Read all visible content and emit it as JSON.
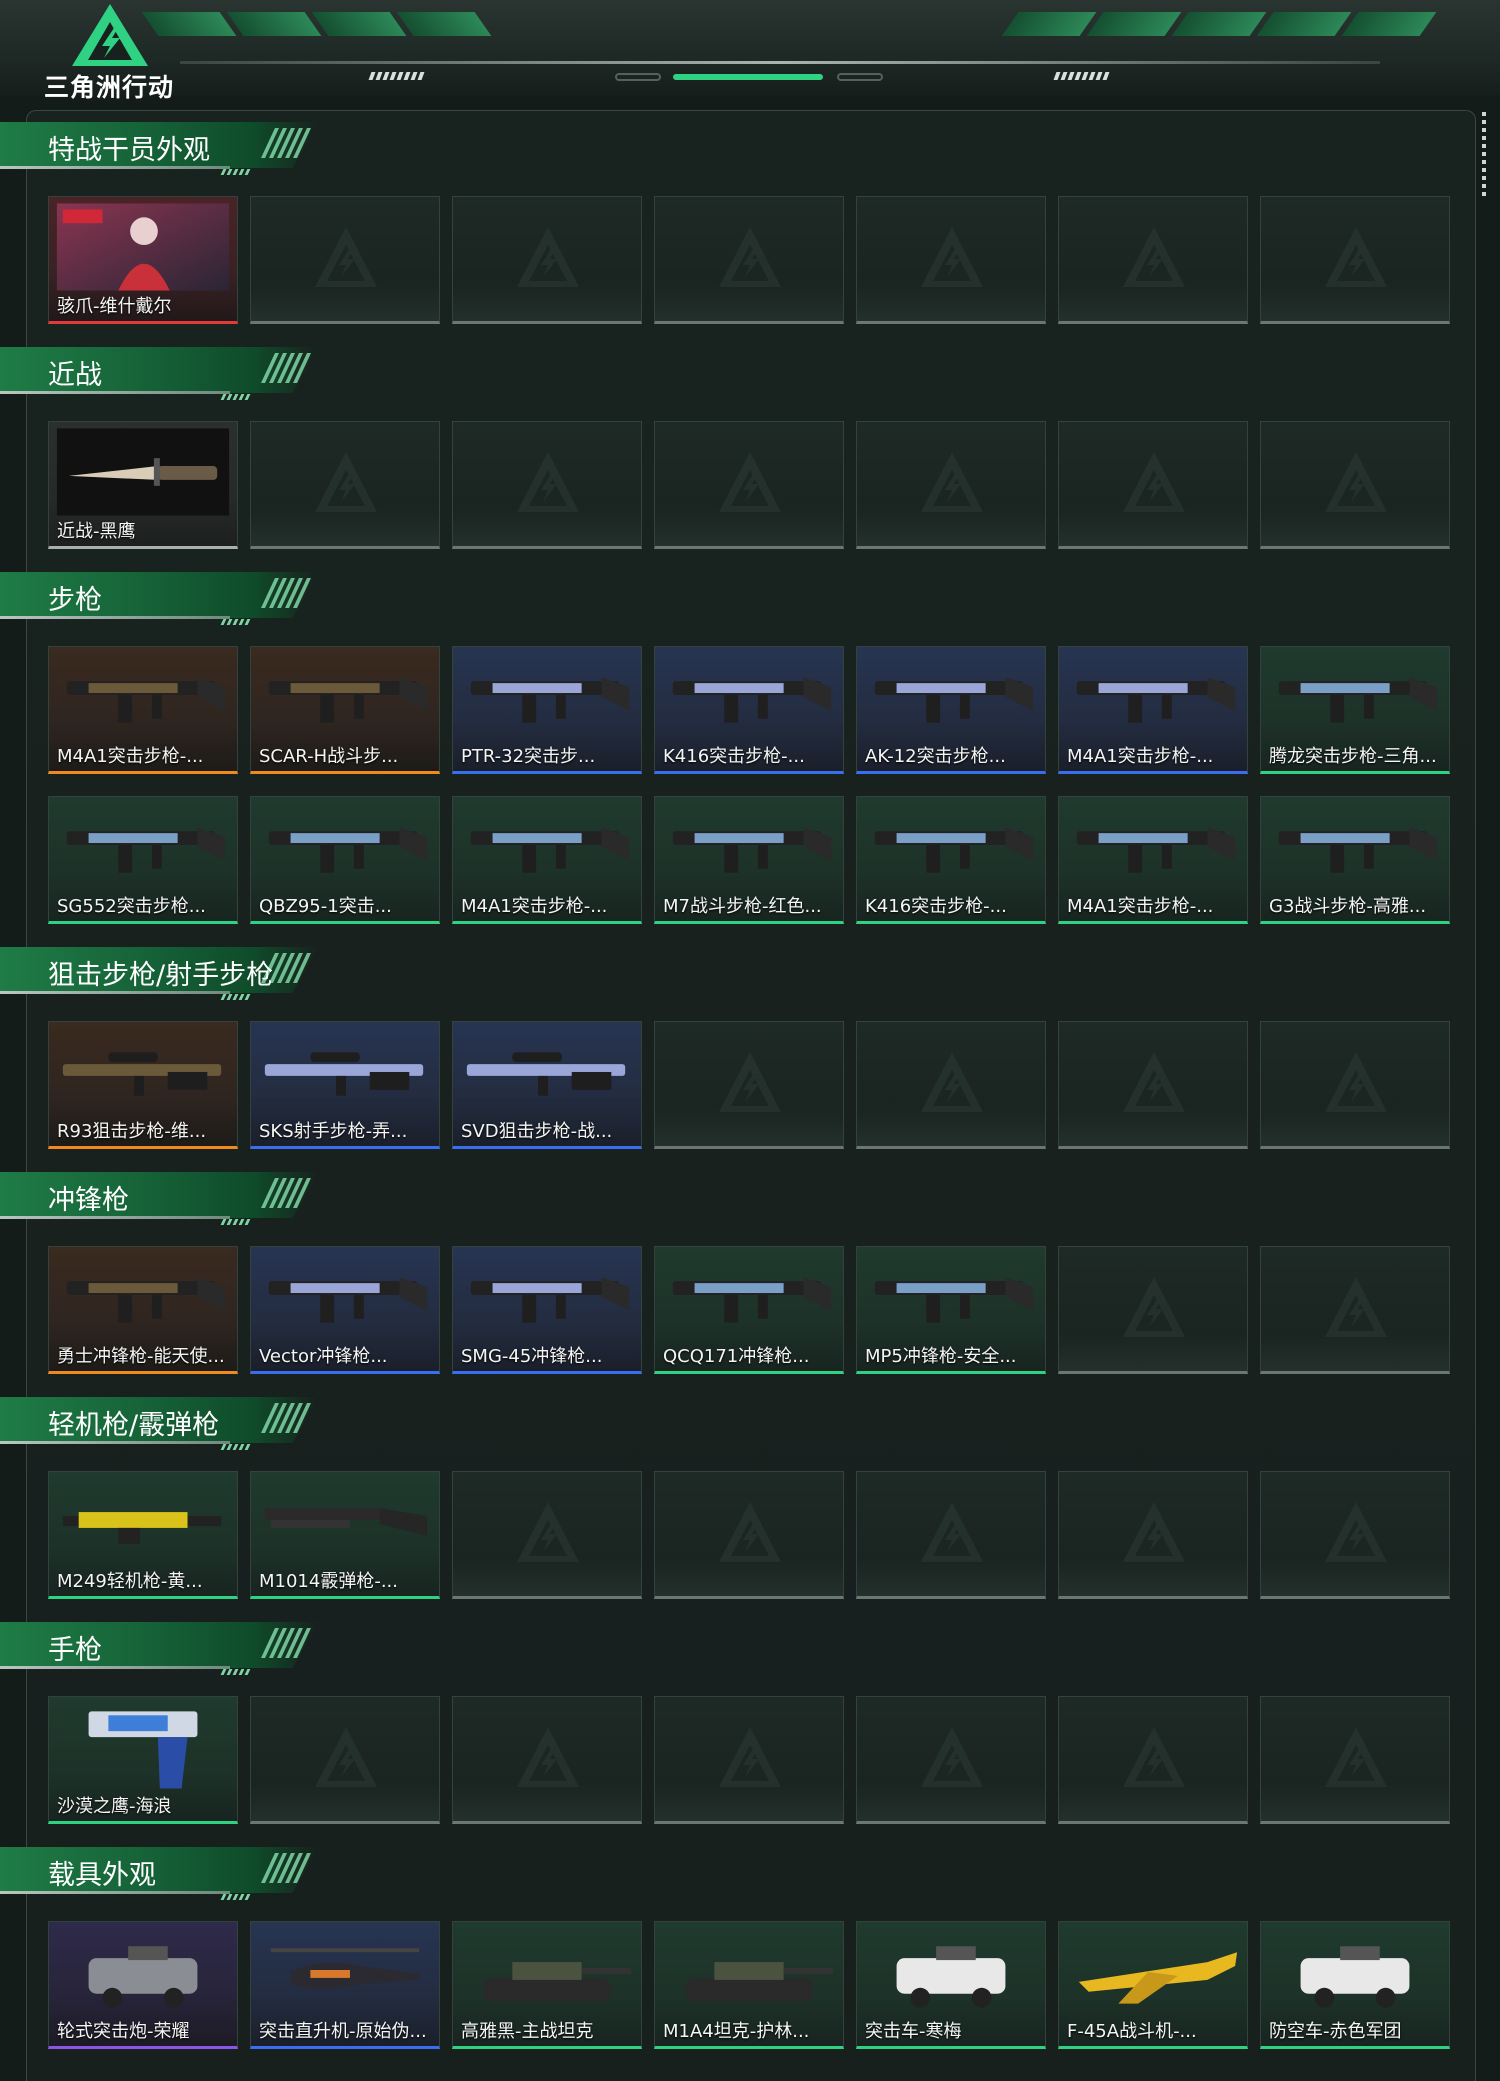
{
  "brand": {
    "name": "三角洲行动"
  },
  "colors": {
    "accent_green": "#2fd283",
    "rarity_orange": "#f08a1c",
    "rarity_blue": "#3a6ef0",
    "rarity_purple": "#8a56e8",
    "rarity_green": "#2fd283",
    "rarity_red": "#e23a3a",
    "rarity_gray": "#a8b0ad"
  },
  "categories": [
    {
      "title": "特战干员外观",
      "rows": [
        [
          {
            "label": "骇爪-维什戴尔",
            "rarity": "red",
            "icon": "operator-portrait"
          },
          null,
          null,
          null,
          null,
          null,
          null
        ]
      ]
    },
    {
      "title": "近战",
      "rows": [
        [
          {
            "label": "近战-黑鹰",
            "rarity": "gray",
            "icon": "knife-icon"
          },
          null,
          null,
          null,
          null,
          null,
          null
        ]
      ]
    },
    {
      "title": "步枪",
      "rows": [
        [
          {
            "label": "M4A1突击步枪-...",
            "rarity": "orange",
            "icon": "rifle-icon"
          },
          {
            "label": "SCAR-H战斗步...",
            "rarity": "orange",
            "icon": "rifle-icon"
          },
          {
            "label": "PTR-32突击步...",
            "rarity": "blue",
            "icon": "rifle-icon"
          },
          {
            "label": "K416突击步枪-...",
            "rarity": "blue",
            "icon": "rifle-icon"
          },
          {
            "label": "AK-12突击步枪...",
            "rarity": "blue",
            "icon": "rifle-icon"
          },
          {
            "label": "M4A1突击步枪-...",
            "rarity": "blue",
            "icon": "rifle-icon"
          },
          {
            "label": "腾龙突击步枪-三角...",
            "rarity": "green",
            "icon": "rifle-icon"
          }
        ],
        [
          {
            "label": "SG552突击步枪...",
            "rarity": "green",
            "icon": "rifle-icon"
          },
          {
            "label": "QBZ95-1突击...",
            "rarity": "green",
            "icon": "rifle-icon"
          },
          {
            "label": "M4A1突击步枪-...",
            "rarity": "green",
            "icon": "rifle-icon"
          },
          {
            "label": "M7战斗步枪-红色...",
            "rarity": "green",
            "icon": "rifle-icon"
          },
          {
            "label": "K416突击步枪-...",
            "rarity": "green",
            "icon": "rifle-icon"
          },
          {
            "label": "M4A1突击步枪-...",
            "rarity": "green",
            "icon": "rifle-icon"
          },
          {
            "label": "G3战斗步枪-高雅...",
            "rarity": "green",
            "icon": "rifle-icon"
          }
        ]
      ]
    },
    {
      "title": "狙击步枪/射手步枪",
      "rows": [
        [
          {
            "label": "R93狙击步枪-维...",
            "rarity": "orange",
            "icon": "sniper-icon"
          },
          {
            "label": "SKS射手步枪-弄...",
            "rarity": "blue",
            "icon": "sniper-icon"
          },
          {
            "label": "SVD狙击步枪-战...",
            "rarity": "blue",
            "icon": "sniper-icon"
          },
          null,
          null,
          null,
          null
        ]
      ]
    },
    {
      "title": "冲锋枪",
      "rows": [
        [
          {
            "label": "勇士冲锋枪-能天使...",
            "rarity": "orange",
            "icon": "smg-icon"
          },
          {
            "label": "Vector冲锋枪...",
            "rarity": "blue",
            "icon": "smg-icon"
          },
          {
            "label": "SMG-45冲锋枪...",
            "rarity": "blue",
            "icon": "smg-icon"
          },
          {
            "label": "QCQ171冲锋枪...",
            "rarity": "green",
            "icon": "smg-icon"
          },
          {
            "label": "MP5冲锋枪-安全...",
            "rarity": "green",
            "icon": "smg-icon"
          },
          null,
          null
        ]
      ]
    },
    {
      "title": "轻机枪/霰弹枪",
      "rows": [
        [
          {
            "label": "M249轻机枪-黄...",
            "rarity": "green",
            "icon": "lmg-icon"
          },
          {
            "label": "M1014霰弹枪-...",
            "rarity": "green",
            "icon": "shotgun-icon"
          },
          null,
          null,
          null,
          null,
          null
        ]
      ]
    },
    {
      "title": "手枪",
      "rows": [
        [
          {
            "label": "沙漠之鹰-海浪",
            "rarity": "green",
            "icon": "pistol-icon"
          },
          null,
          null,
          null,
          null,
          null,
          null
        ]
      ]
    },
    {
      "title": "载具外观",
      "rows": [
        [
          {
            "label": "轮式突击炮-荣耀",
            "rarity": "purple",
            "icon": "vehicle-icon"
          },
          {
            "label": "突击直升机-原始伪...",
            "rarity": "blue",
            "icon": "helicopter-icon"
          },
          {
            "label": "高雅黑-主战坦克",
            "rarity": "green",
            "icon": "tank-icon"
          },
          {
            "label": "M1A4坦克-护林...",
            "rarity": "green",
            "icon": "tank-icon"
          },
          {
            "label": "突击车-寒梅",
            "rarity": "green",
            "icon": "vehicle-icon"
          },
          {
            "label": "F-45A战斗机-...",
            "rarity": "green",
            "icon": "jet-icon"
          },
          {
            "label": "防空车-赤色军团",
            "rarity": "green",
            "icon": "vehicle-icon"
          }
        ]
      ]
    }
  ]
}
